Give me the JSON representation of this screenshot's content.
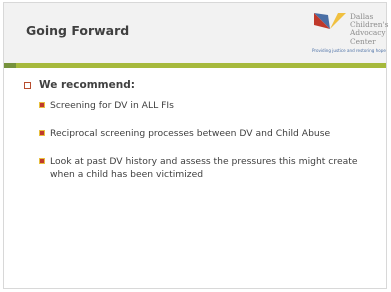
{
  "slide": {
    "title": "Going Forward",
    "logo": {
      "name_lines": [
        "Dallas",
        "Children's",
        "Advocacy",
        "Center"
      ],
      "tagline": "Providing justice and restoring hope"
    },
    "bullets": {
      "lead": "We recommend:",
      "items": [
        "Screening for DV in ALL FIs",
        "Reciprocal screening processes between DV and Child Abuse",
        "Look at past DV history and assess the pressures this might create when a child has been victimized"
      ]
    }
  },
  "colors": {
    "accent": "#a6b93c",
    "bullet": "#c0392b",
    "title": "#404040"
  }
}
